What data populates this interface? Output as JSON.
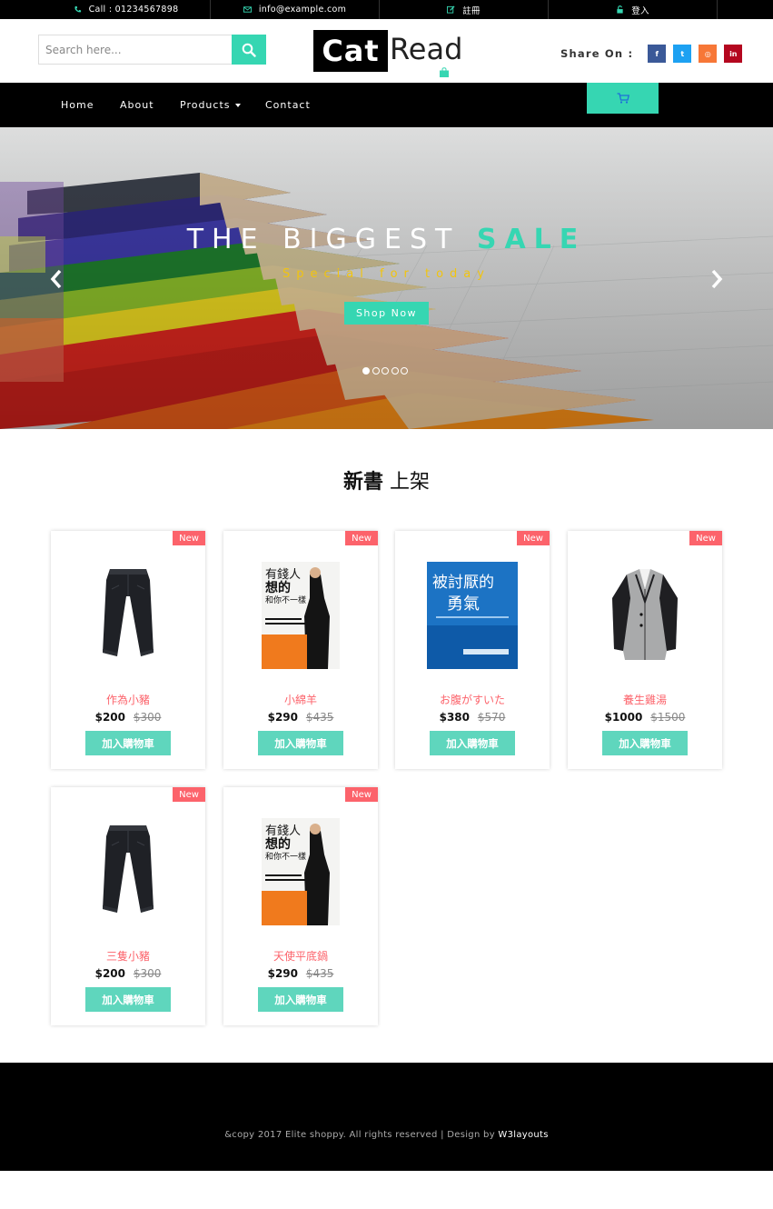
{
  "topbar": {
    "call": "Call : 01234567898",
    "email": "info@example.com",
    "register": "註冊",
    "login": "登入"
  },
  "header": {
    "search_placeholder": "Search here...",
    "logo_part1": "Cat",
    "logo_part2": "Read",
    "share_label": "Share On :",
    "social": [
      {
        "icon": "facebook-icon",
        "glyph": "f",
        "color": "#3b5998"
      },
      {
        "icon": "twitter-icon",
        "glyph": "t",
        "color": "#1da1f2"
      },
      {
        "icon": "instagram-icon",
        "glyph": "◎",
        "color": "#f77737"
      },
      {
        "icon": "linkedin-icon",
        "glyph": "in",
        "color": "#b4071f"
      }
    ]
  },
  "nav": {
    "home": "Home",
    "about": "About",
    "products": "Products",
    "contact": "Contact"
  },
  "banner": {
    "title": "THE BIGGEST",
    "title_highlight": "SALE",
    "subtitle": "Special for today",
    "cta": "Shop Now",
    "slides": 5,
    "active_slide": 1
  },
  "section": {
    "title_bold": "新書",
    "title_rest": "上架"
  },
  "products": [
    {
      "badge": "New",
      "name": "作為小豬",
      "price": "$200",
      "old_price": "$300",
      "button": "加入購物車",
      "image": "jeans"
    },
    {
      "badge": "New",
      "name": "小綿羊",
      "price": "$290",
      "old_price": "$435",
      "button": "加入購物車",
      "image": "book-rich"
    },
    {
      "badge": "New",
      "name": "お腹がすいた",
      "price": "$380",
      "old_price": "$570",
      "button": "加入購物車",
      "image": "book-courage"
    },
    {
      "badge": "New",
      "name": "養生雞湯",
      "price": "$1000",
      "old_price": "$1500",
      "button": "加入購物車",
      "image": "blazer"
    },
    {
      "badge": "New",
      "name": "三隻小豬",
      "price": "$200",
      "old_price": "$300",
      "button": "加入購物車",
      "image": "jeans"
    },
    {
      "badge": "New",
      "name": "天使平底鍋",
      "price": "$290",
      "old_price": "$435",
      "button": "加入購物車",
      "image": "book-rich"
    }
  ],
  "book_covers": {
    "rich_title_1": "有錢人",
    "rich_title_2": "想的",
    "rich_title_3": "和你不一樣",
    "courage_title_1": "被討厭的",
    "courage_title_2": "勇氣"
  },
  "footer": {
    "copy": "&copy 2017 Elite shoppy. All rights reserved | Design by",
    "link": "W3layouts"
  },
  "colors": {
    "accent": "#36d6b2",
    "badge": "#fc636b",
    "product_name": "#fc636b",
    "banner_subtitle": "#f1c40f"
  }
}
